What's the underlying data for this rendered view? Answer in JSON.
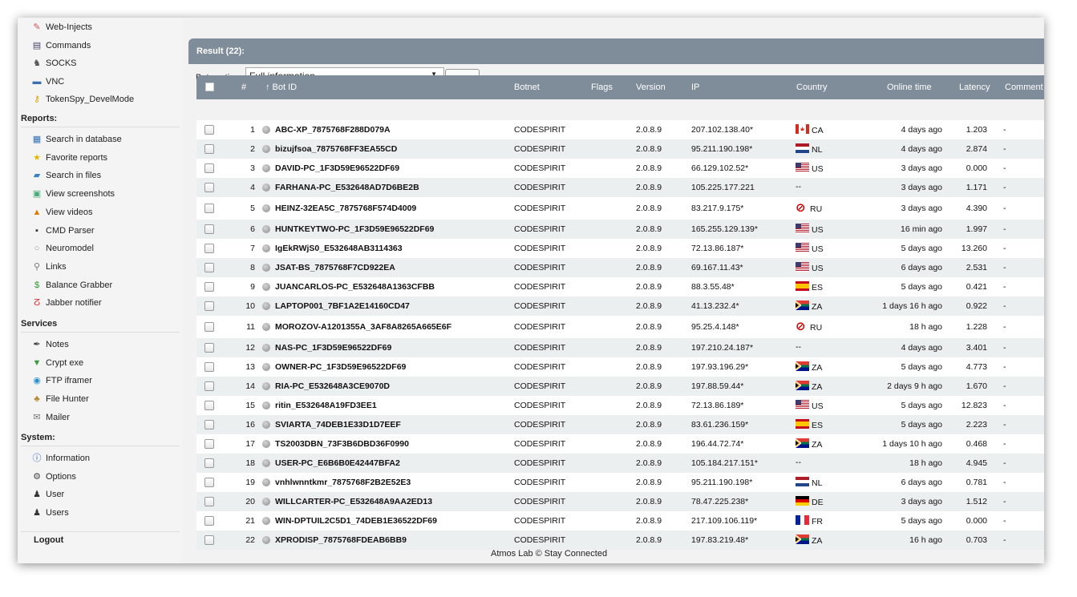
{
  "sidebar": {
    "items_top": [
      {
        "label": "Web-Injects",
        "icon": "syringe-icon"
      },
      {
        "label": "Commands",
        "icon": "clipboard-icon"
      },
      {
        "label": "SOCKS",
        "icon": "socks-icon"
      },
      {
        "label": "VNC",
        "icon": "monitor-icon"
      },
      {
        "label": "TokenSpy_DevelMode",
        "icon": "key-icon"
      }
    ],
    "reports_header": "Reports:",
    "reports": [
      {
        "label": "Search in database",
        "icon": "database-icon"
      },
      {
        "label": "Favorite reports",
        "icon": "star-icon"
      },
      {
        "label": "Search in files",
        "icon": "folder-icon"
      },
      {
        "label": "View screenshots",
        "icon": "screenshot-icon"
      },
      {
        "label": "View videos",
        "icon": "video-icon"
      },
      {
        "label": "CMD Parser",
        "icon": "terminal-icon"
      },
      {
        "label": "Neuromodel",
        "icon": "circle-icon"
      },
      {
        "label": "Links",
        "icon": "magnifier-icon"
      },
      {
        "label": "Balance Grabber",
        "icon": "dollar-icon"
      },
      {
        "label": "Jabber notifier",
        "icon": "jabber-icon"
      }
    ],
    "services_header": "Services",
    "services": [
      {
        "label": "Notes",
        "icon": "pen-icon"
      },
      {
        "label": "Crypt exe",
        "icon": "shield-icon"
      },
      {
        "label": "FTP iframer",
        "icon": "ftp-icon"
      },
      {
        "label": "File Hunter",
        "icon": "hunter-icon"
      },
      {
        "label": "Mailer",
        "icon": "mail-icon"
      }
    ],
    "system_header": "System:",
    "system": [
      {
        "label": "Information",
        "icon": "info-icon"
      },
      {
        "label": "Options",
        "icon": "gear-icon"
      },
      {
        "label": "User",
        "icon": "user-icon"
      },
      {
        "label": "Users",
        "icon": "users-icon"
      }
    ],
    "logout": "Logout"
  },
  "result": {
    "title": "Result (22):"
  },
  "toolbar": {
    "label": "Bots action:",
    "selected": "Full information",
    "go": ">>"
  },
  "table": {
    "headers": {
      "num": "#",
      "bot": "↑ Bot ID",
      "botnet": "Botnet",
      "flags": "Flags",
      "version": "Version",
      "ip": "IP",
      "country": "Country",
      "online": "Online time",
      "latency": "Latency",
      "comment": "Comment"
    },
    "rows": [
      {
        "n": "1",
        "bot": "ABC-XP_7875768F288D079A",
        "botnet": "CODESPIRIT",
        "ver": "2.0.8.9",
        "ip": "207.102.138.40*",
        "cc": "CA",
        "online": "4 days ago",
        "lat": "1.203",
        "cmt": "-"
      },
      {
        "n": "2",
        "bot": "bizujfsoa_7875768FF3EA55CD",
        "botnet": "CODESPIRIT",
        "ver": "2.0.8.9",
        "ip": "95.211.190.198*",
        "cc": "NL",
        "online": "4 days ago",
        "lat": "2.874",
        "cmt": "-"
      },
      {
        "n": "3",
        "bot": "DAVID-PC_1F3D59E96522DF69",
        "botnet": "CODESPIRIT",
        "ver": "2.0.8.9",
        "ip": "66.129.102.52*",
        "cc": "US",
        "online": "3 days ago",
        "lat": "0.000",
        "cmt": "-"
      },
      {
        "n": "4",
        "bot": "FARHANA-PC_E532648AD7D6BE2B",
        "botnet": "CODESPIRIT",
        "ver": "2.0.8.9",
        "ip": "105.225.177.221",
        "cc": "--",
        "online": "3 days ago",
        "lat": "1.171",
        "cmt": "-"
      },
      {
        "n": "5",
        "bot": "HEINZ-32EA5C_7875768F574D4009",
        "botnet": "CODESPIRIT",
        "ver": "2.0.8.9",
        "ip": "83.217.9.175*",
        "cc": "RU",
        "online": "3 days ago",
        "lat": "4.390",
        "cmt": "-"
      },
      {
        "n": "6",
        "bot": "HUNTKEYTWO-PC_1F3D59E96522DF69",
        "botnet": "CODESPIRIT",
        "ver": "2.0.8.9",
        "ip": "165.255.129.139*",
        "cc": "US",
        "online": "16 min ago",
        "lat": "1.997",
        "cmt": "-"
      },
      {
        "n": "7",
        "bot": "IgEkRWjS0_E532648AB3114363",
        "botnet": "CODESPIRIT",
        "ver": "2.0.8.9",
        "ip": "72.13.86.187*",
        "cc": "US",
        "online": "5 days ago",
        "lat": "13.260",
        "cmt": "-"
      },
      {
        "n": "8",
        "bot": "JSAT-BS_7875768F7CD922EA",
        "botnet": "CODESPIRIT",
        "ver": "2.0.8.9",
        "ip": "69.167.11.43*",
        "cc": "US",
        "online": "6 days ago",
        "lat": "2.531",
        "cmt": "-"
      },
      {
        "n": "9",
        "bot": "JUANCARLOS-PC_E532648A1363CFBB",
        "botnet": "CODESPIRIT",
        "ver": "2.0.8.9",
        "ip": "88.3.55.48*",
        "cc": "ES",
        "online": "5 days ago",
        "lat": "0.421",
        "cmt": "-"
      },
      {
        "n": "10",
        "bot": "LAPTOP001_7BF1A2E14160CD47",
        "botnet": "CODESPIRIT",
        "ver": "2.0.8.9",
        "ip": "41.13.232.4*",
        "cc": "ZA",
        "online": "1 days 16 h ago",
        "lat": "0.922",
        "cmt": "-"
      },
      {
        "n": "11",
        "bot": "MOROZOV-A1201355A_3AF8A8265A665E6F",
        "botnet": "CODESPIRIT",
        "ver": "2.0.8.9",
        "ip": "95.25.4.148*",
        "cc": "RU",
        "online": "18 h ago",
        "lat": "1.228",
        "cmt": "-"
      },
      {
        "n": "12",
        "bot": "NAS-PC_1F3D59E96522DF69",
        "botnet": "CODESPIRIT",
        "ver": "2.0.8.9",
        "ip": "197.210.24.187*",
        "cc": "--",
        "online": "4 days ago",
        "lat": "3.401",
        "cmt": "-"
      },
      {
        "n": "13",
        "bot": "OWNER-PC_1F3D59E96522DF69",
        "botnet": "CODESPIRIT",
        "ver": "2.0.8.9",
        "ip": "197.93.196.29*",
        "cc": "ZA",
        "online": "5 days ago",
        "lat": "4.773",
        "cmt": "-"
      },
      {
        "n": "14",
        "bot": "RIA-PC_E532648A3CE9070D",
        "botnet": "CODESPIRIT",
        "ver": "2.0.8.9",
        "ip": "197.88.59.44*",
        "cc": "ZA",
        "online": "2 days 9 h ago",
        "lat": "1.670",
        "cmt": "-"
      },
      {
        "n": "15",
        "bot": "ritin_E532648A19FD3EE1",
        "botnet": "CODESPIRIT",
        "ver": "2.0.8.9",
        "ip": "72.13.86.189*",
        "cc": "US",
        "online": "5 days ago",
        "lat": "12.823",
        "cmt": "-"
      },
      {
        "n": "16",
        "bot": "SVIARTA_74DEB1E33D1D7EEF",
        "botnet": "CODESPIRIT",
        "ver": "2.0.8.9",
        "ip": "83.61.236.159*",
        "cc": "ES",
        "online": "5 days ago",
        "lat": "2.223",
        "cmt": "-"
      },
      {
        "n": "17",
        "bot": "TS2003DBN_73F3B6DBD36F0990",
        "botnet": "CODESPIRIT",
        "ver": "2.0.8.9",
        "ip": "196.44.72.74*",
        "cc": "ZA",
        "online": "1 days 10 h ago",
        "lat": "0.468",
        "cmt": "-"
      },
      {
        "n": "18",
        "bot": "USER-PC_E6B6B0E42447BFA2",
        "botnet": "CODESPIRIT",
        "ver": "2.0.8.9",
        "ip": "105.184.217.151*",
        "cc": "--",
        "online": "18 h ago",
        "lat": "4.945",
        "cmt": "-"
      },
      {
        "n": "19",
        "bot": "vnhlwnntkmr_7875768F2B2E52E3",
        "botnet": "CODESPIRIT",
        "ver": "2.0.8.9",
        "ip": "95.211.190.198*",
        "cc": "NL",
        "online": "6 days ago",
        "lat": "0.781",
        "cmt": "-"
      },
      {
        "n": "20",
        "bot": "WILLCARTER-PC_E532648A9AA2ED13",
        "botnet": "CODESPIRIT",
        "ver": "2.0.8.9",
        "ip": "78.47.225.238*",
        "cc": "DE",
        "online": "3 days ago",
        "lat": "1.512",
        "cmt": "-"
      },
      {
        "n": "21",
        "bot": "WIN-DPTUIL2C5D1_74DEB1E36522DF69",
        "botnet": "CODESPIRIT",
        "ver": "2.0.8.9",
        "ip": "217.109.106.119*",
        "cc": "FR",
        "online": "5 days ago",
        "lat": "0.000",
        "cmt": "-"
      },
      {
        "n": "22",
        "bot": "XPRODISP_7875768FDEAB6BB9",
        "botnet": "CODESPIRIT",
        "ver": "2.0.8.9",
        "ip": "197.83.219.48*",
        "cc": "ZA",
        "online": "16 h ago",
        "lat": "0.703",
        "cmt": "-"
      }
    ]
  },
  "footer": "Atmos Lab © Stay Connected",
  "colors": {
    "header_bg": "#7f8c9a",
    "row_alt": "#eceff0",
    "no_entry": "#cc0000"
  }
}
